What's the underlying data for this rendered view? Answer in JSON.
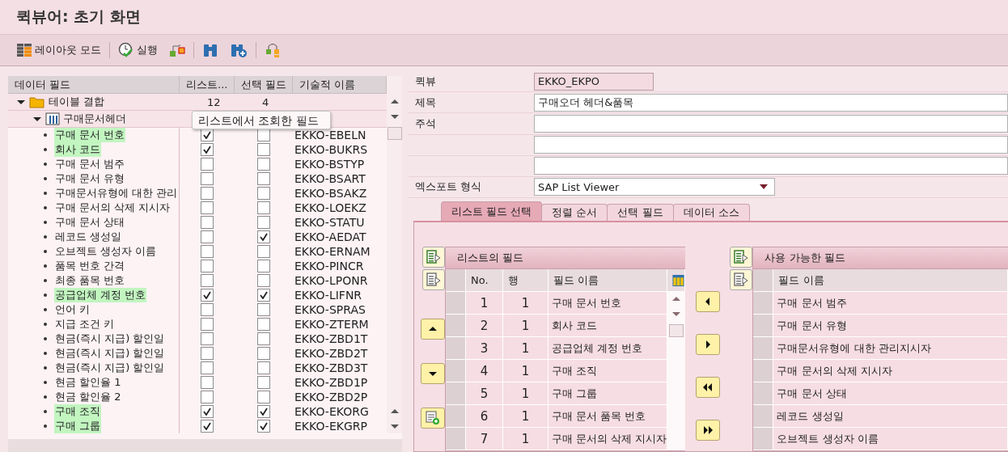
{
  "window": {
    "title": "퀵뷰어: 초기 화면"
  },
  "toolbar": [
    {
      "kind": "layout",
      "label": "레이아웃 모드"
    },
    {
      "kind": "execute",
      "label": "실행"
    },
    {
      "kind": "hierarchy"
    },
    {
      "kind": "find"
    },
    {
      "kind": "find_next"
    },
    {
      "kind": "tree"
    }
  ],
  "data_fields": {
    "columns": [
      "데이터 필드",
      "리스트...",
      "선택 필드",
      "기술적 이름"
    ],
    "tree": {
      "label": "테이블 결합",
      "expanded": true,
      "list_count": "12",
      "selection_count": "4",
      "children": [
        {
          "label": "구매문서헤더",
          "expanded": true,
          "fields": [
            {
              "label": "구매 문서 번호",
              "in_list": true,
              "selection": false,
              "technical_name": "EKKO-EBELN"
            },
            {
              "label": "회사 코드",
              "in_list": true,
              "selection": false,
              "technical_name": "EKKO-BUKRS"
            },
            {
              "label": "구매 문서 범주",
              "in_list": false,
              "selection": false,
              "technical_name": "EKKO-BSTYP"
            },
            {
              "label": "구매 문서 유형",
              "in_list": false,
              "selection": false,
              "technical_name": "EKKO-BSART"
            },
            {
              "label": "구매문서유형에 대한 관리",
              "in_list": false,
              "selection": false,
              "technical_name": "EKKO-BSAKZ"
            },
            {
              "label": "구매 문서의 삭제 지시자",
              "in_list": false,
              "selection": false,
              "technical_name": "EKKO-LOEKZ"
            },
            {
              "label": "구매 문서 상태",
              "in_list": false,
              "selection": false,
              "technical_name": "EKKO-STATU"
            },
            {
              "label": "레코드 생성일",
              "in_list": false,
              "selection": true,
              "technical_name": "EKKO-AEDAT"
            },
            {
              "label": "오브젝트 생성자 이름",
              "in_list": false,
              "selection": false,
              "technical_name": "EKKO-ERNAM"
            },
            {
              "label": "품목 번호 간격",
              "in_list": false,
              "selection": false,
              "technical_name": "EKKO-PINCR"
            },
            {
              "label": "최종 품목 번호",
              "in_list": false,
              "selection": false,
              "technical_name": "EKKO-LPONR"
            },
            {
              "label": "공급업체 계정 번호",
              "in_list": true,
              "selection": true,
              "technical_name": "EKKO-LIFNR"
            },
            {
              "label": "언어 키",
              "in_list": false,
              "selection": false,
              "technical_name": "EKKO-SPRAS"
            },
            {
              "label": "지급 조건 키",
              "in_list": false,
              "selection": false,
              "technical_name": "EKKO-ZTERM"
            },
            {
              "label": "현금(즉시 지급) 할인일",
              "in_list": false,
              "selection": false,
              "technical_name": "EKKO-ZBD1T"
            },
            {
              "label": "현금(즉시 지급) 할인일",
              "in_list": false,
              "selection": false,
              "technical_name": "EKKO-ZBD2T"
            },
            {
              "label": "현금(즉시 지급) 할인일",
              "in_list": false,
              "selection": false,
              "technical_name": "EKKO-ZBD3T"
            },
            {
              "label": "현금 할인율 1",
              "in_list": false,
              "selection": false,
              "technical_name": "EKKO-ZBD1P"
            },
            {
              "label": "현금 할인율 2",
              "in_list": false,
              "selection": false,
              "technical_name": "EKKO-ZBD2P"
            },
            {
              "label": "구매 조직",
              "in_list": true,
              "selection": true,
              "technical_name": "EKKO-EKORG"
            },
            {
              "label": "구매 그룹",
              "in_list": true,
              "selection": true,
              "technical_name": "EKKO-EKGRP"
            }
          ]
        }
      ]
    },
    "tooltip": "리스트에서 조회한 필드"
  },
  "form": [
    {
      "kind": "readonly",
      "label": "퀵뷰",
      "value": "EKKO_EKPO"
    },
    {
      "kind": "input",
      "label": "제목",
      "value": "구매오더 헤더&품목"
    },
    {
      "kind": "input",
      "label": "주석"
    },
    {
      "kind": "input"
    },
    {
      "kind": "input"
    },
    {
      "kind": "dropdown",
      "label": "엑스포트 형식",
      "value": "SAP List Viewer"
    }
  ],
  "tabs": [
    {
      "label": "리스트 필드 선택",
      "selected": true
    },
    {
      "label": "정렬 순서",
      "selected": false
    },
    {
      "label": "선택 필드",
      "selected": false
    },
    {
      "label": "데이터 소스",
      "selected": false
    }
  ],
  "list_fields": {
    "title": "리스트의 필드",
    "columns": [
      "No.",
      "행",
      "필드 이름"
    ],
    "rows": [
      {
        "no": "1",
        "line": "1",
        "name": "구매 문서 번호"
      },
      {
        "no": "2",
        "line": "1",
        "name": "회사 코드"
      },
      {
        "no": "3",
        "line": "1",
        "name": "공급업체 계정 번호"
      },
      {
        "no": "4",
        "line": "1",
        "name": "구매 조직"
      },
      {
        "no": "5",
        "line": "1",
        "name": "구매 그룹"
      },
      {
        "no": "6",
        "line": "1",
        "name": "구매 문서 품목 번호"
      },
      {
        "no": "7",
        "line": "1",
        "name": "구매 문서의 삭제 지시자"
      }
    ]
  },
  "side_buttons": [
    {
      "kind": "up"
    },
    {
      "kind": "down"
    },
    {
      "kind": "add"
    }
  ],
  "move_buttons": [
    {
      "kind": "left"
    },
    {
      "kind": "right"
    },
    {
      "kind": "all_left"
    },
    {
      "kind": "all_right"
    }
  ],
  "available_fields": {
    "title": "사용 가능한 필드",
    "columns": [
      "필드 이름"
    ],
    "rows": [
      {
        "name": "구매 문서 범주"
      },
      {
        "name": "구매 문서 유형"
      },
      {
        "name": "구매문서유형에 대한 관리지시자"
      },
      {
        "name": "구매 문서의 삭제 지시자"
      },
      {
        "name": "구매 문서 상태"
      },
      {
        "name": "레코드 생성일"
      },
      {
        "name": "오브젝트 생성자 이름"
      }
    ]
  }
}
